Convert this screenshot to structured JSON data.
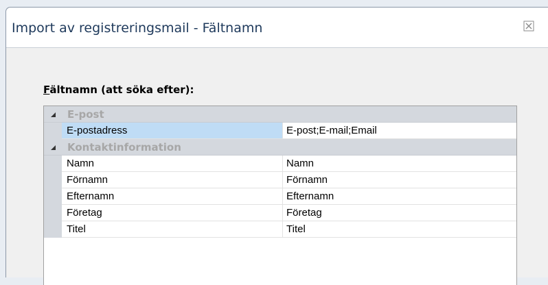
{
  "window": {
    "title": "Import av registreringsmail - Fältnamn",
    "close_icon": "close-icon"
  },
  "section": {
    "accel": "F",
    "label_rest": "ältnamn (att söka efter):"
  },
  "colors": {
    "title_text": "#1e395b",
    "category_bg": "#d4d8de",
    "category_text": "#a7a7a7",
    "selected_bg": "#bfdcf5"
  },
  "grid": {
    "categories": [
      {
        "label": "E-post",
        "expanded": true,
        "rows": [
          {
            "name": "E-postadress",
            "value": "E-post;E-mail;Email",
            "selected": true
          }
        ]
      },
      {
        "label": "Kontaktinformation",
        "expanded": true,
        "rows": [
          {
            "name": "Namn",
            "value": "Namn"
          },
          {
            "name": "Förnamn",
            "value": "Förnamn"
          },
          {
            "name": "Efternamn",
            "value": "Efternamn"
          },
          {
            "name": "Företag",
            "value": "Företag"
          },
          {
            "name": "Titel",
            "value": "Titel"
          }
        ]
      }
    ]
  }
}
